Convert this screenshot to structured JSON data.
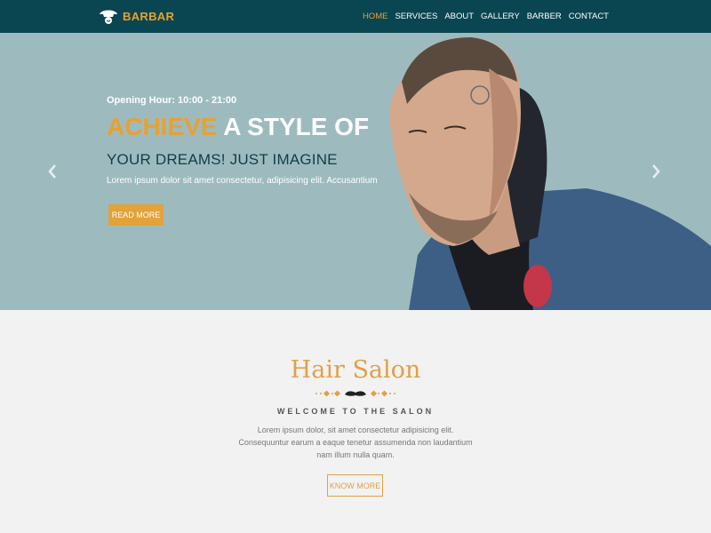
{
  "brand": {
    "name": "BARBAR",
    "icon": "barber-logo-icon"
  },
  "nav": {
    "items": [
      {
        "label": "HOME",
        "active": true
      },
      {
        "label": "SERVICES",
        "active": false
      },
      {
        "label": "ABOUT",
        "active": false
      },
      {
        "label": "GALLERY",
        "active": false
      },
      {
        "label": "BARBER",
        "active": false
      },
      {
        "label": "CONTACT",
        "active": false
      }
    ]
  },
  "hero": {
    "opening_hour": "Opening Hour: 10:00 - 21:00",
    "headline_accent": "ACHIEVE",
    "headline_rest": " A STYLE OF",
    "subheadline": "YOUR DREAMS! JUST IMAGINE",
    "lorem": "Lorem ipsum dolor sit amet consectetur, adipisicing elit. Accusantium",
    "read_more_label": "READ MORE",
    "prev_icon": "chevron-left-icon",
    "next_icon": "chevron-right-icon"
  },
  "salon": {
    "title": "Hair Salon",
    "divider_icon": "mustache-icon",
    "subtitle": "WELCOME TO THE SALON",
    "lorem": "Lorem ipsum dolor, sit amet consectetur adipisicing elit. Consequuntur earum a eaque tenetur assumenda non laudantium nam illum nulla quam.",
    "know_more_label": "KNOW MORE"
  },
  "colors": {
    "nav_bg": "#0a4652",
    "accent": "#e8a12f",
    "hero_bg": "#9dbbbf",
    "page_bg": "#f2f2f2"
  }
}
